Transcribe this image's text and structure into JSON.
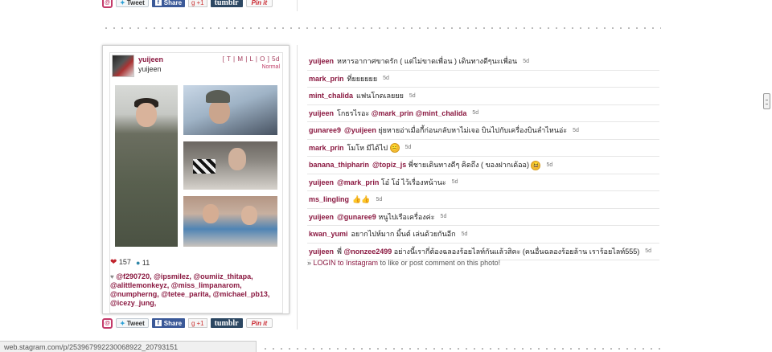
{
  "share": {
    "tweet": "Tweet",
    "facebook": "Share",
    "gplus": "+1",
    "tumblr": "tumblr",
    "pinit": "Pin it"
  },
  "post": {
    "username": "yuijeen",
    "fullname": "yuijeen",
    "size_links": "[ T | M | L | O ]",
    "age": "5d",
    "filter": "Normal",
    "likes": "157",
    "comments_count": "11",
    "likers": "@f290720, @ipsmilez, @oumiiz_thitapa, @alittlemonkeyz, @miss_limpanarom, @numpherng, @tetee_parita, @michael_pb13, @icezy_jung,"
  },
  "comments": [
    {
      "user": "yuijeen",
      "text": "หหารอากาศขาดรัก ( แต่ไม่ขาดเพื่อน ) เดินทางดีๆนะเพื่อน",
      "mention": "",
      "after": "",
      "age": "5d"
    },
    {
      "user": "mark_prin",
      "text": "ที่ยยยยยย",
      "mention": "",
      "after": "",
      "age": "5d"
    },
    {
      "user": "mint_chalida",
      "text": "แฟนโกดเลยยย",
      "mention": "",
      "after": "",
      "age": "5d"
    },
    {
      "user": "yuijeen",
      "text": "โกธรไรอะ ",
      "mention": "@mark_prin @mint_chalida",
      "after": "",
      "age": "5d"
    },
    {
      "user": "gunaree9",
      "text": "",
      "mention": "@yuijeen",
      "after": " ยุ่ยหายอ่าเมื่อกี้ก่อนกลับหาไม่เจอ บินไปกับเครื่องบินลำไหนอ่ะ",
      "age": "5d"
    },
    {
      "user": "mark_prin",
      "text": "โมโห มีได้ไป ",
      "mention": "",
      "after": "",
      "age": "5d",
      "emoji": "😑"
    },
    {
      "user": "banana_thipharin",
      "text": "",
      "mention": "@topiz_js",
      "after": " พี่ชายเดินทางดีๆ คิดถึง ( ของฝากเด้ออ) ",
      "age": "5d",
      "emoji": "😆"
    },
    {
      "user": "yuijeen",
      "text": "",
      "mention": "@mark_prin",
      "after": " โอ๋ โอ๋ ไว้เรื่องหน้านะ",
      "age": "5d"
    },
    {
      "user": "ms_lingling",
      "text": "",
      "mention": "",
      "after": "",
      "age": "5d",
      "thumbs": "👍👍"
    },
    {
      "user": "yuijeen",
      "text": "",
      "mention": "@gunaree9",
      "after": " หนูไปเรือเครื่องค่ะ",
      "age": "5d"
    },
    {
      "user": "kwan_yumi",
      "text": "อยากไปห์มาก มิ้นต์ เล่นด้วยกันอีก",
      "mention": "",
      "after": "",
      "age": "5d"
    },
    {
      "user": "yuijeen",
      "text": "พี่ ",
      "mention": "@nonzee2499",
      "after": " อย่างนี้เรากี่ต้องฉลองร้อยไลท์กันแล้วสิคะ (คนอื่นฉลองร้อยล้าน เราร้อยไลท์555)",
      "age": "5d"
    }
  ],
  "login": {
    "prefix": "» ",
    "link": "LOGIN to Instagram",
    "suffix": " to like or post comment on this photo!"
  },
  "statusbar": "web.stagram.com/p/253967992230068922_20793151"
}
